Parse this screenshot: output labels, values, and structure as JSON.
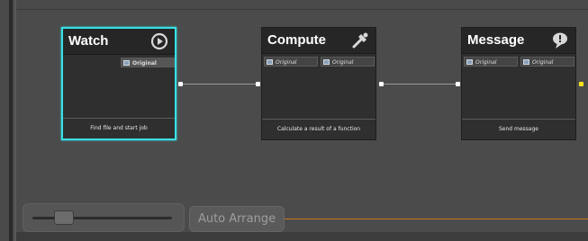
{
  "nodes": [
    {
      "title": "Watch",
      "ports": [
        "Original"
      ],
      "footer": "Find file and start job",
      "icon": "play-circle-icon"
    },
    {
      "title": "Compute",
      "ports": [
        "Original",
        "Original"
      ],
      "footer": "Calculate a result of a function",
      "icon": "tools-icon"
    },
    {
      "title": "Message",
      "ports": [
        "Original",
        "Original"
      ],
      "footer": "Send message",
      "icon": "speech-bubble-icon"
    }
  ],
  "toolbar": {
    "auto_arrange_label": "Auto Arrange"
  },
  "zoom_slider": {
    "level": 0.2
  },
  "colors": {
    "selection": "#37e0e6",
    "output_port": "#ffe21a",
    "progress_line": "#c8761c"
  }
}
